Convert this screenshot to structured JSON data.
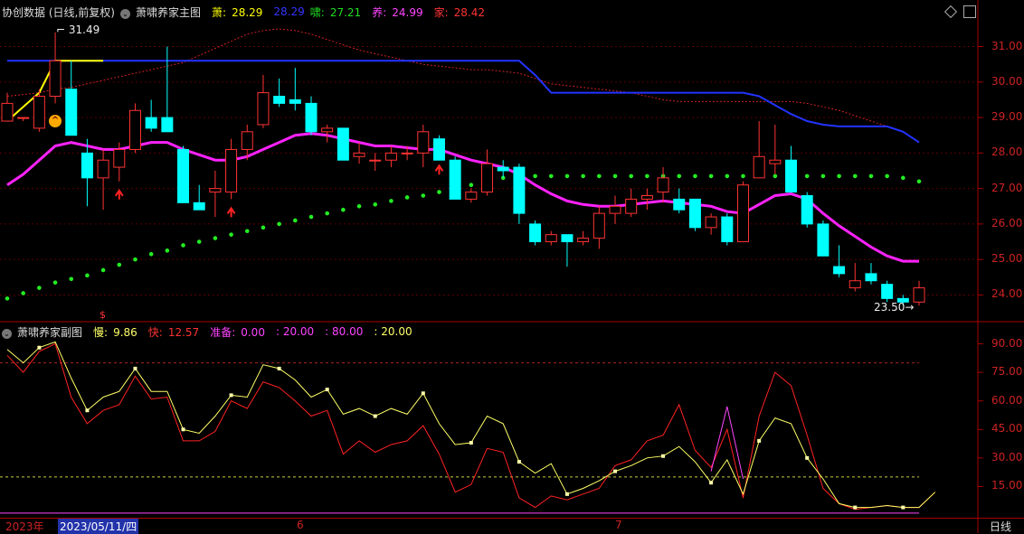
{
  "main_header": {
    "title": "协创数据 (日线,前复权)",
    "indicator_name": "萧啸养家主图",
    "i1_label": "萧:",
    "i1_value": "28.29",
    "i2_value": "28.29",
    "i3_label": "啸:",
    "i3_value": "27.21",
    "i4_label": "养:",
    "i4_value": "24.99",
    "i5_label": "家:",
    "i5_value": "28.42",
    "colors": {
      "i1": "#ffff00",
      "i2": "#2222ff",
      "i3": "#22dd22",
      "i4": "#ff33ff",
      "i5": "#ff3333"
    }
  },
  "sub_header": {
    "indicator_name": "萧啸养家副图",
    "slow_label": "慢:",
    "slow_value": "9.86",
    "fast_label": "快:",
    "fast_value": "12.57",
    "ready_label": "准备:",
    "ready_value": "0.00",
    "v2": "20.00",
    "v3": "80.00",
    "v4": "20.00"
  },
  "main_axis": [
    "31.00",
    "30.00",
    "29.00",
    "28.00",
    "27.00",
    "26.00",
    "25.00",
    "24.00"
  ],
  "sub_axis": [
    "90.00",
    "75.00",
    "60.00",
    "45.00",
    "30.00",
    "15.00"
  ],
  "annotations": {
    "high": "31.49",
    "low": "23.50",
    "marker": "$"
  },
  "bottom": {
    "year": "2023年",
    "date": "2023/05/11/四",
    "m6": "6",
    "m7": "7",
    "period": "日线"
  },
  "chart_data": {
    "type": "candlestick",
    "y_range_main": [
      23.4,
      31.6
    ],
    "y_range_sub": [
      0,
      95
    ],
    "candles": [
      [
        28.9,
        29.7,
        29.0,
        29.4
      ],
      [
        29.0,
        29.0,
        28.9,
        29.0
      ],
      [
        28.7,
        29.8,
        28.6,
        29.6
      ],
      [
        29.6,
        31.4,
        29.4,
        30.6
      ],
      [
        29.8,
        30.6,
        28.5,
        28.5
      ],
      [
        28.0,
        28.4,
        26.5,
        27.3
      ],
      [
        27.3,
        28.1,
        26.4,
        27.8
      ],
      [
        27.6,
        28.3,
        27.2,
        28.1
      ],
      [
        28.1,
        29.4,
        28.0,
        29.2
      ],
      [
        29.0,
        29.5,
        28.6,
        28.7
      ],
      [
        29.0,
        31.0,
        28.6,
        28.6
      ],
      [
        28.1,
        28.2,
        26.6,
        26.6
      ],
      [
        26.6,
        27.1,
        26.5,
        26.4
      ],
      [
        26.9,
        27.5,
        26.2,
        27.0
      ],
      [
        26.9,
        28.4,
        26.7,
        28.1
      ],
      [
        28.1,
        28.8,
        27.8,
        28.6
      ],
      [
        28.8,
        30.2,
        28.7,
        29.7
      ],
      [
        29.6,
        30.1,
        29.3,
        29.4
      ],
      [
        29.5,
        30.4,
        29.2,
        29.4
      ],
      [
        29.4,
        29.6,
        28.5,
        28.6
      ],
      [
        28.6,
        28.8,
        28.3,
        28.7
      ],
      [
        28.7,
        28.5,
        27.8,
        27.8
      ],
      [
        27.9,
        28.3,
        27.7,
        28.0
      ],
      [
        27.8,
        28.0,
        27.5,
        27.8
      ],
      [
        27.8,
        28.2,
        27.6,
        28.0
      ],
      [
        28.0,
        28.2,
        27.8,
        28.0
      ],
      [
        28.0,
        28.8,
        27.6,
        28.6
      ],
      [
        28.4,
        28.5,
        27.9,
        27.8
      ],
      [
        27.8,
        27.9,
        26.7,
        26.7
      ],
      [
        26.7,
        27.0,
        26.6,
        26.9
      ],
      [
        26.9,
        28.1,
        26.8,
        27.7
      ],
      [
        27.6,
        27.8,
        27.3,
        27.5
      ],
      [
        27.6,
        27.7,
        26.0,
        26.3
      ],
      [
        26.0,
        26.1,
        25.4,
        25.5
      ],
      [
        25.5,
        25.8,
        25.4,
        25.7
      ],
      [
        25.7,
        25.7,
        24.8,
        25.5
      ],
      [
        25.5,
        25.8,
        25.4,
        25.6
      ],
      [
        25.6,
        26.5,
        25.3,
        26.3
      ],
      [
        26.3,
        26.8,
        26.0,
        26.5
      ],
      [
        26.3,
        27.0,
        26.2,
        26.7
      ],
      [
        26.7,
        27.0,
        26.4,
        26.8
      ],
      [
        26.9,
        27.6,
        26.6,
        27.3
      ],
      [
        26.7,
        27.0,
        26.3,
        26.4
      ],
      [
        26.7,
        26.7,
        25.8,
        25.9
      ],
      [
        25.9,
        26.3,
        25.7,
        26.2
      ],
      [
        26.2,
        26.3,
        25.4,
        25.5
      ],
      [
        25.5,
        27.2,
        25.5,
        27.1
      ],
      [
        27.3,
        28.9,
        27.3,
        27.9
      ],
      [
        27.7,
        28.8,
        27.4,
        27.8
      ],
      [
        27.8,
        28.2,
        26.9,
        26.9
      ],
      [
        26.8,
        26.9,
        25.9,
        26.0
      ],
      [
        26.0,
        26.1,
        25.1,
        25.1
      ],
      [
        24.8,
        25.4,
        24.5,
        24.6
      ],
      [
        24.2,
        24.9,
        24.1,
        24.4
      ],
      [
        24.6,
        24.9,
        24.3,
        24.4
      ],
      [
        24.3,
        24.4,
        23.8,
        23.9
      ],
      [
        23.9,
        24.0,
        23.7,
        23.8
      ],
      [
        23.8,
        24.4,
        23.7,
        24.2
      ]
    ],
    "ma_pink": [
      27.1,
      27.4,
      27.8,
      28.2,
      28.3,
      28.2,
      28.1,
      28.1,
      28.2,
      28.3,
      28.3,
      28.1,
      27.95,
      27.8,
      27.8,
      27.9,
      28.1,
      28.3,
      28.5,
      28.55,
      28.5,
      28.4,
      28.3,
      28.2,
      28.2,
      28.15,
      28.1,
      28.1,
      27.95,
      27.8,
      27.7,
      27.6,
      27.4,
      27.1,
      26.85,
      26.65,
      26.55,
      26.5,
      26.5,
      26.55,
      26.6,
      26.65,
      26.6,
      26.55,
      26.5,
      26.35,
      26.3,
      26.55,
      26.8,
      26.85,
      26.7,
      26.3,
      25.95,
      25.65,
      25.35,
      25.1,
      24.95,
      24.95
    ],
    "blue_line": [
      30.6,
      30.6,
      30.6,
      30.6,
      30.6,
      30.6,
      30.6,
      30.6,
      30.6,
      30.6,
      30.6,
      30.6,
      30.6,
      30.6,
      30.6,
      30.6,
      30.6,
      30.6,
      30.6,
      30.6,
      30.6,
      30.6,
      30.6,
      30.6,
      30.6,
      30.6,
      30.6,
      30.6,
      30.6,
      30.6,
      30.6,
      30.6,
      30.6,
      30.2,
      29.7,
      29.7,
      29.7,
      29.7,
      29.7,
      29.7,
      29.7,
      29.7,
      29.7,
      29.7,
      29.7,
      29.7,
      29.7,
      29.6,
      29.35,
      29.1,
      28.9,
      28.8,
      28.75,
      28.75,
      28.75,
      28.75,
      28.6,
      28.3
    ],
    "red_dotted": [
      29.6,
      29.65,
      29.7,
      29.8,
      29.85,
      29.95,
      30.05,
      30.15,
      30.25,
      30.35,
      30.45,
      30.55,
      30.75,
      30.95,
      31.15,
      31.35,
      31.45,
      31.5,
      31.45,
      31.35,
      31.2,
      31.05,
      30.9,
      30.8,
      30.7,
      30.6,
      30.5,
      30.45,
      30.4,
      30.35,
      30.35,
      30.3,
      30.25,
      30.1,
      29.95,
      29.9,
      29.85,
      29.8,
      29.75,
      29.7,
      29.6,
      29.5,
      29.45,
      29.45,
      29.45,
      29.45,
      29.45,
      29.45,
      29.45,
      29.45,
      29.4,
      29.3,
      29.2,
      29.05,
      28.9,
      28.75,
      28.6,
      28.3
    ],
    "green_dots": [
      23.9,
      24.05,
      24.2,
      24.35,
      24.45,
      24.55,
      24.7,
      24.85,
      25.0,
      25.15,
      25.25,
      25.4,
      25.5,
      25.6,
      25.7,
      25.8,
      25.9,
      26.0,
      26.1,
      26.2,
      26.3,
      26.4,
      26.5,
      26.55,
      26.65,
      26.75,
      26.8,
      26.9,
      27.0,
      27.1,
      27.15,
      27.3,
      27.35,
      27.35,
      27.35,
      27.35,
      27.35,
      27.35,
      27.35,
      27.35,
      27.35,
      27.35,
      27.35,
      27.35,
      27.35,
      27.35,
      27.35,
      27.35,
      27.35,
      27.35,
      27.35,
      27.35,
      27.35,
      27.35,
      27.35,
      27.35,
      27.3,
      27.2
    ],
    "sub_yellow": [
      87,
      80,
      88,
      91,
      72,
      55,
      62,
      65,
      77,
      65,
      65,
      45,
      43,
      52,
      63,
      62,
      79,
      77,
      71,
      62,
      66,
      53,
      56,
      52,
      56,
      53,
      64,
      48,
      37,
      38,
      52,
      48,
      28,
      22,
      27,
      11,
      14,
      18,
      23,
      26,
      30,
      31,
      36,
      28,
      17,
      29,
      11,
      39,
      51,
      48,
      30,
      19,
      6,
      4,
      4,
      5,
      4,
      4,
      12
    ],
    "sub_red": [
      84,
      75,
      86,
      90,
      62,
      48,
      55,
      58,
      73,
      61,
      62,
      39,
      39,
      44,
      60,
      56,
      70,
      67,
      60,
      52,
      55,
      32,
      39,
      33,
      37,
      39,
      47,
      32,
      12,
      16,
      35,
      33,
      9,
      4,
      10,
      8,
      11,
      14,
      26,
      29,
      39,
      42,
      58,
      34,
      25,
      45,
      9,
      52,
      75,
      68,
      42,
      14,
      6,
      3,
      4,
      5,
      4,
      4,
      12
    ],
    "sub_magenta": [
      [
        44,
        23
      ],
      [
        45,
        57
      ],
      [
        46,
        19
      ]
    ]
  }
}
